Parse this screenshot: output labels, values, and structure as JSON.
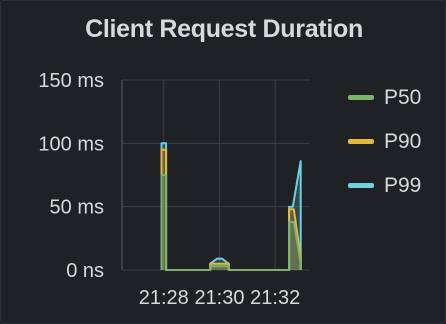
{
  "panel": {
    "title": "Client Request Duration"
  },
  "colors": {
    "background": "#1f2125",
    "grid": "#3a3d42",
    "axis": "#5a5d63",
    "text": "#d8d9da"
  },
  "chart_data": {
    "type": "area",
    "title": "Client Request Duration",
    "xlabel": "",
    "ylabel": "",
    "y_unit": "ms",
    "ylim": [
      0,
      150
    ],
    "yticks": [
      {
        "value": 0,
        "label": "0 ns"
      },
      {
        "value": 50,
        "label": "50 ms"
      },
      {
        "value": 100,
        "label": "100 ms"
      },
      {
        "value": 150,
        "label": "150 ms"
      }
    ],
    "xlim": [
      "21:26:30",
      "21:33:15"
    ],
    "xticks": [
      "21:28",
      "21:30",
      "21:32"
    ],
    "grid": true,
    "legend_position": "right",
    "series": [
      {
        "name": "P50",
        "color": "#7eb26d",
        "points": [
          {
            "x": "21:27:55",
            "y": 0
          },
          {
            "x": "21:27:55",
            "y": 75
          },
          {
            "x": "21:28:05",
            "y": 75
          },
          {
            "x": "21:28:05",
            "y": 0
          },
          {
            "x": "21:29:40",
            "y": 0
          },
          {
            "x": "21:29:40",
            "y": 3
          },
          {
            "x": "21:30:20",
            "y": 3
          },
          {
            "x": "21:30:20",
            "y": 0
          },
          {
            "x": "21:32:30",
            "y": 0
          },
          {
            "x": "21:32:30",
            "y": 38
          },
          {
            "x": "21:32:40",
            "y": 38
          },
          {
            "x": "21:32:55",
            "y": 5
          },
          {
            "x": "21:32:55",
            "y": 0
          }
        ]
      },
      {
        "name": "P90",
        "color": "#eab839",
        "points": [
          {
            "x": "21:27:55",
            "y": 0
          },
          {
            "x": "21:27:55",
            "y": 95
          },
          {
            "x": "21:28:05",
            "y": 95
          },
          {
            "x": "21:28:05",
            "y": 0
          },
          {
            "x": "21:29:40",
            "y": 0
          },
          {
            "x": "21:29:40",
            "y": 5
          },
          {
            "x": "21:30:20",
            "y": 5
          },
          {
            "x": "21:30:20",
            "y": 0
          },
          {
            "x": "21:32:30",
            "y": 0
          },
          {
            "x": "21:32:30",
            "y": 48
          },
          {
            "x": "21:32:40",
            "y": 48
          },
          {
            "x": "21:32:55",
            "y": 10
          },
          {
            "x": "21:32:55",
            "y": 0
          }
        ]
      },
      {
        "name": "P99",
        "color": "#6ed0e0",
        "points": [
          {
            "x": "21:27:55",
            "y": 0
          },
          {
            "x": "21:27:55",
            "y": 100
          },
          {
            "x": "21:28:05",
            "y": 100
          },
          {
            "x": "21:28:05",
            "y": 0
          },
          {
            "x": "21:29:40",
            "y": 0
          },
          {
            "x": "21:29:40",
            "y": 5
          },
          {
            "x": "21:29:55",
            "y": 9
          },
          {
            "x": "21:30:05",
            "y": 9
          },
          {
            "x": "21:30:20",
            "y": 5
          },
          {
            "x": "21:30:20",
            "y": 0
          },
          {
            "x": "21:32:30",
            "y": 0
          },
          {
            "x": "21:32:30",
            "y": 50
          },
          {
            "x": "21:32:38",
            "y": 50
          },
          {
            "x": "21:32:55",
            "y": 86
          },
          {
            "x": "21:32:55",
            "y": 0
          }
        ]
      }
    ]
  }
}
